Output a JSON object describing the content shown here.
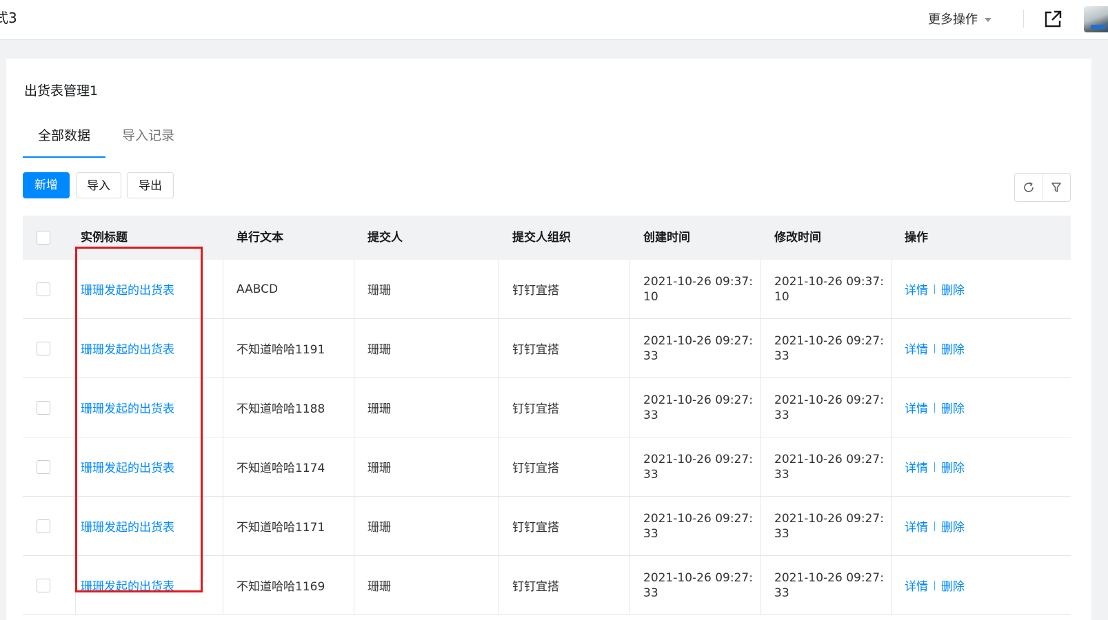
{
  "topbar": {
    "app_title": "式3",
    "more_actions": "更多操作"
  },
  "page": {
    "title": "出货表管理1",
    "tabs": [
      {
        "label": "全部数据",
        "active": true
      },
      {
        "label": "导入记录",
        "active": false
      }
    ]
  },
  "toolbar": {
    "add_label": "新增",
    "import_label": "导入",
    "export_label": "导出",
    "icons": [
      "refresh-icon",
      "filter-icon"
    ]
  },
  "table": {
    "columns": [
      "实例标题",
      "单行文本",
      "提交人",
      "提交人组织",
      "创建时间",
      "修改时间",
      "操作"
    ],
    "rows": [
      {
        "title": "珊珊发起的出货表",
        "text": "AABCD",
        "submitter": "珊珊",
        "org": "钉钉宜搭",
        "created": "2021-10-26 09:37:10",
        "modified": "2021-10-26 09:37:10",
        "detail": "详情",
        "delete": "删除"
      },
      {
        "title": "珊珊发起的出货表",
        "text": "不知道哈哈1191",
        "submitter": "珊珊",
        "org": "钉钉宜搭",
        "created": "2021-10-26 09:27:33",
        "modified": "2021-10-26 09:27:33",
        "detail": "详情",
        "delete": "删除"
      },
      {
        "title": "珊珊发起的出货表",
        "text": "不知道哈哈1188",
        "submitter": "珊珊",
        "org": "钉钉宜搭",
        "created": "2021-10-26 09:27:33",
        "modified": "2021-10-26 09:27:33",
        "detail": "详情",
        "delete": "删除"
      },
      {
        "title": "珊珊发起的出货表",
        "text": "不知道哈哈1174",
        "submitter": "珊珊",
        "org": "钉钉宜搭",
        "created": "2021-10-26 09:27:33",
        "modified": "2021-10-26 09:27:33",
        "detail": "详情",
        "delete": "删除"
      },
      {
        "title": "珊珊发起的出货表",
        "text": "不知道哈哈1171",
        "submitter": "珊珊",
        "org": "钉钉宜搭",
        "created": "2021-10-26 09:27:33",
        "modified": "2021-10-26 09:27:33",
        "detail": "详情",
        "delete": "删除"
      },
      {
        "title": "珊珊发起的出货表",
        "text": "不知道哈哈1169",
        "submitter": "珊珊",
        "org": "钉钉宜搭",
        "created": "2021-10-26 09:27:33",
        "modified": "2021-10-26 09:27:33",
        "detail": "详情",
        "delete": "删除"
      }
    ]
  },
  "colors": {
    "primary": "#0089ff",
    "highlight": "#e0191e",
    "header_bg": "#f1f2f4"
  }
}
